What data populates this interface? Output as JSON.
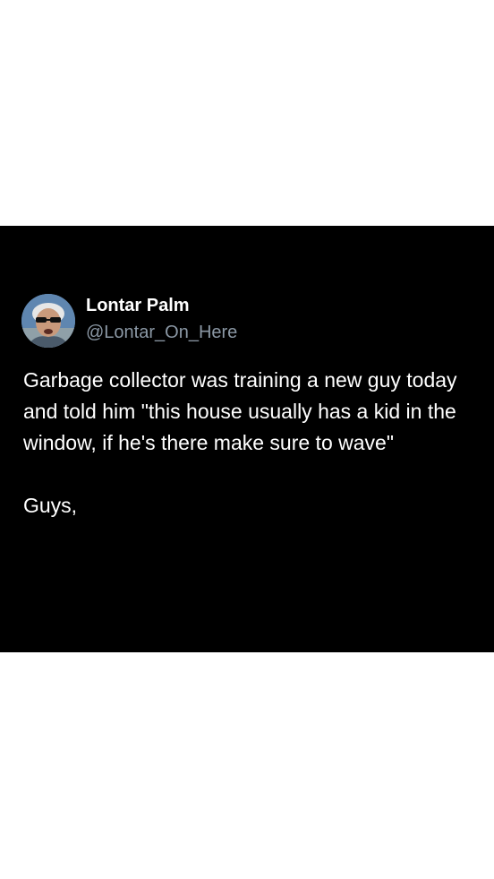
{
  "tweet": {
    "author_name": "Lontar Palm",
    "author_handle": "@Lontar_On_Here",
    "avatar_icon": "profile-photo",
    "text": "Garbage collector was training a new guy today and told him \"this house usually has a kid in the window, if he's there make sure to wave\"",
    "closing": "Guys,"
  },
  "colors": {
    "page_background": "#ffffff",
    "card_background": "#000000",
    "primary_text": "#ffffff",
    "secondary_text": "#8b98a5"
  }
}
